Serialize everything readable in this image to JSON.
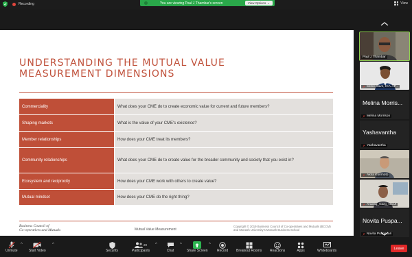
{
  "topbar": {
    "recording_label": "Recording",
    "banner_text": "You are viewing Paul J Thambar's screen",
    "view_options_label": "View Options",
    "view_label": "View"
  },
  "slide": {
    "title": "UNDERSTANDING THE MUTUAL VALUE MEASUREMENT DIMENSIONS",
    "rows": [
      {
        "dimension": "Commerciality",
        "question": "What does your CME do to create economic value for current and future members?"
      },
      {
        "dimension": "Shaping markets",
        "question": "What is the value of your CME's existence?"
      },
      {
        "dimension": "Member relationships",
        "question": "How does your CME treat its members?"
      },
      {
        "dimension": "Community relationships",
        "question": "What does your CME do to create value for the broader community and society that you exist in?"
      },
      {
        "dimension": "Ecosystem and reciprocity",
        "question": "How does your CME work with others to create value?"
      },
      {
        "dimension": "Mutual mindset",
        "question": "How does your CME do the right thing?"
      }
    ],
    "footer_logo_line1": "Business Council of",
    "footer_logo_line2": "Co-operatives and Mutuals",
    "footer_center": "Mutual Value Measurement",
    "footer_right_line1": "Copyright © 2019 Business Council of Co-operatives and Mutuals (BCCM)",
    "footer_right_line2": "and Monash University's Monash Business School"
  },
  "participants": [
    {
      "name": "Paul J Thambar",
      "type": "video",
      "active": true,
      "muted": false
    },
    {
      "name": "Mohit Dave, ICA-AP...",
      "type": "video",
      "active": false,
      "muted": true
    },
    {
      "name": "Melina Morrison",
      "display": "Melina Morris...",
      "type": "name",
      "active": false,
      "muted": true
    },
    {
      "name": "Yashavantha",
      "display": "Yashavantha",
      "type": "name",
      "active": false,
      "muted": true
    },
    {
      "name": "Akira Kurimoto",
      "type": "video",
      "active": false,
      "muted": true
    },
    {
      "name": "Anurag_Garg_NCUI",
      "type": "video",
      "active": false,
      "muted": true
    },
    {
      "name": "Novita Puspasari",
      "display": "Novita Puspa...",
      "type": "name",
      "active": false,
      "muted": true
    }
  ],
  "toolbar": {
    "unmute": "Unmute",
    "start_video": "Start Video",
    "security": "Security",
    "participants": "Participants",
    "participants_count": "20",
    "chat": "Chat",
    "share_screen": "Share Screen",
    "record": "Record",
    "breakout_rooms": "Breakout Rooms",
    "reactions": "Reactions",
    "apps": "Apps",
    "whiteboards": "Whiteboards",
    "leave": "Leave"
  },
  "colors": {
    "slide_accent": "#c0513b",
    "table_label_bg": "#bf4f38",
    "table_question_bg": "#e3e0dd",
    "banner_green": "#2aa84a",
    "share_green": "#2db550",
    "leave_red": "#e02828",
    "active_outline": "#8fd14f"
  }
}
